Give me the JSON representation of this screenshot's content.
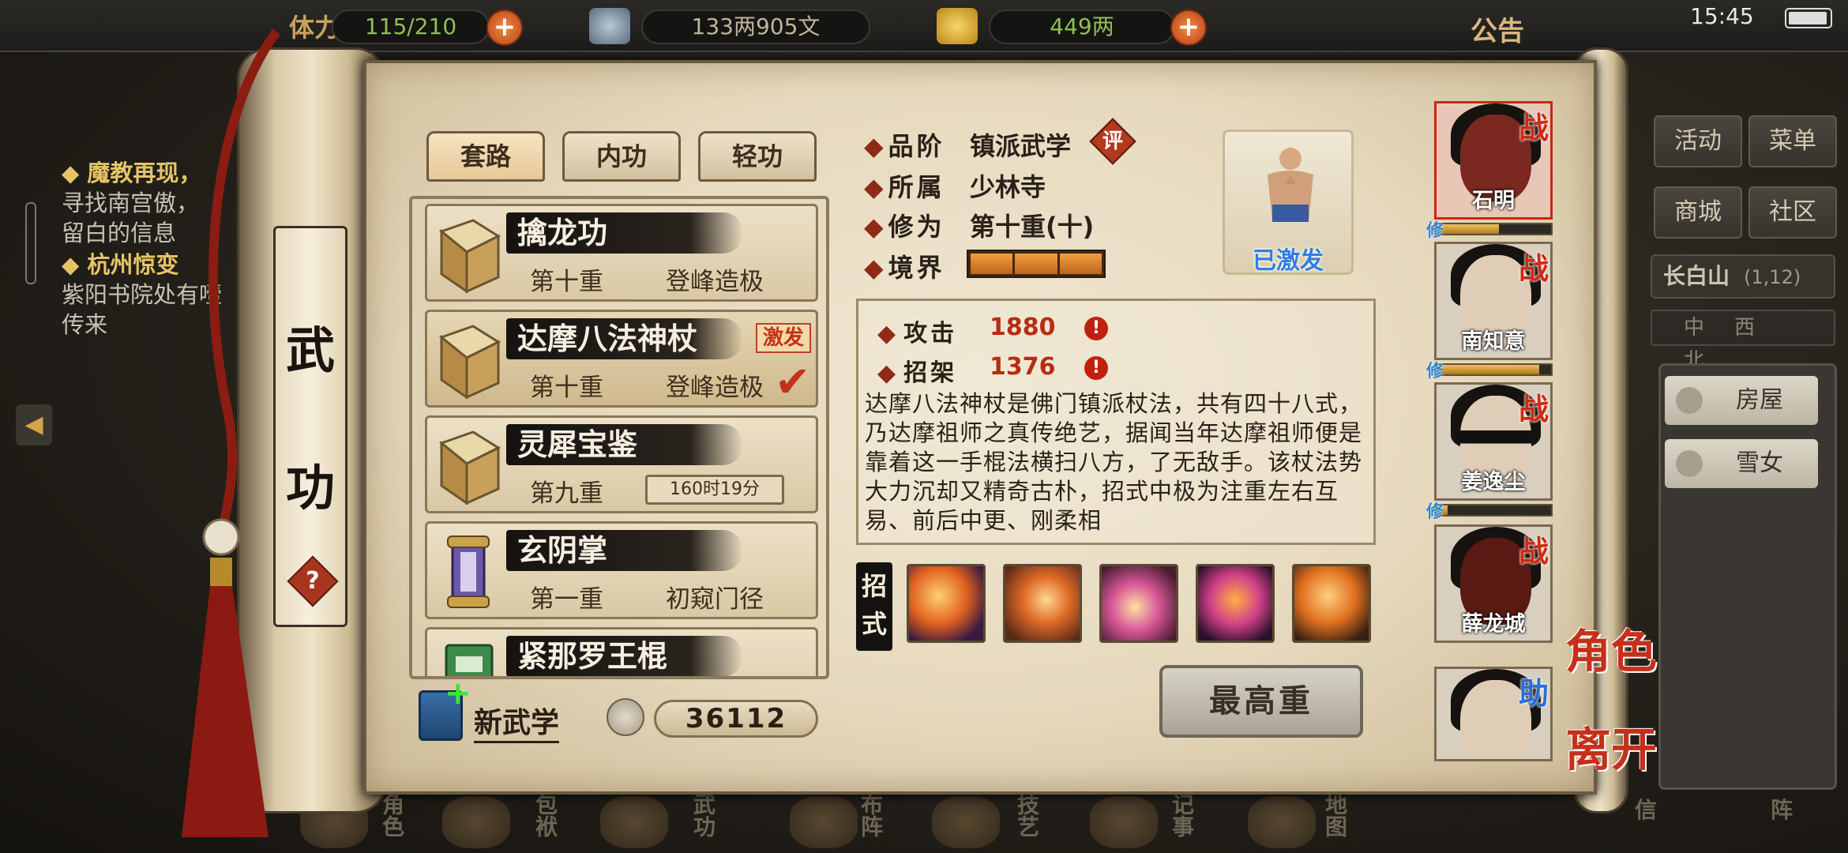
{
  "topbar": {
    "stamina_label": "体力",
    "stamina": "115/210",
    "silver": "133两905文",
    "gold": "449两",
    "notice": "公告",
    "time": "15:45"
  },
  "quests": [
    {
      "title": "魔教再现，",
      "desc": "寻找南宫傲，\n留白的信息"
    },
    {
      "title": "杭州惊变",
      "desc": "紫阳书院处有噎\n传来"
    }
  ],
  "side_menu": {
    "buttons": [
      "活动",
      "菜单",
      "商城",
      "社区"
    ],
    "region_name": "长白山",
    "region_coords": "(1,12)",
    "compass": "中西北",
    "list": [
      "房屋",
      "雪女"
    ]
  },
  "bottom_nav": [
    "角色",
    "包袱",
    "武功",
    "布阵",
    "技艺",
    "记事",
    "地图",
    "信",
    "阵"
  ],
  "panel_title": [
    "武",
    "功"
  ],
  "help_icon": "?",
  "tabs": [
    "套路",
    "内功",
    "轻功"
  ],
  "skills": [
    {
      "name": "擒龙功",
      "level": "第十重",
      "rank": "登峰造极"
    },
    {
      "name": "达摩八法神杖",
      "level": "第十重",
      "rank": "登峰造极",
      "badge": "激发",
      "selected": true
    },
    {
      "name": "灵犀宝鉴",
      "level": "第九重",
      "timer": "160时19分"
    },
    {
      "name": "玄阴掌",
      "level": "第一重",
      "rank": "初窥门径"
    },
    {
      "name": "紧那罗王棍",
      "level": "",
      "rank": ""
    }
  ],
  "new_skill_label": "新武学",
  "points": "36112",
  "detail": {
    "grade_label": "品阶",
    "grade": "镇派武学",
    "review_btn": "评",
    "sect_label": "所属",
    "sect": "少林寺",
    "cultivation_label": "修为",
    "cultivation": "第十重(十)",
    "realm_label": "境界",
    "realm_progress": 1.0,
    "portrait_status": "已激发",
    "attack_label": "攻击",
    "attack": "1880",
    "parry_label": "招架",
    "parry": "1376",
    "description": "达摩八法神杖是佛门镇派杖法，共有四十八式，乃达摩祖师之真传绝艺，据闻当年达摩祖师便是靠着这一手棍法横扫八方，了无敌手。该杖法势大力沉却又精奇古朴，招式中极为注重左右互易、前后中更、刚柔相",
    "moves_label": "招式",
    "max_button": "最高重"
  },
  "characters": [
    {
      "name": "石明",
      "tag": "战",
      "xp": 0.55
    },
    {
      "name": "南知意",
      "tag": "战",
      "xp": 0.9
    },
    {
      "name": "姜逸尘",
      "tag": "战",
      "xp": 0.1
    },
    {
      "name": "薛龙城",
      "tag": "战"
    },
    {
      "name": "",
      "tag": "助"
    }
  ],
  "xiu_label": "修",
  "side_labels": {
    "role": "角色",
    "leave": "离开"
  },
  "colors": {
    "accent_red": "#c4321a",
    "parchment": "#e6d9bd",
    "activated_blue": "#2f7fe0",
    "orange_bar": "#e0862c"
  }
}
